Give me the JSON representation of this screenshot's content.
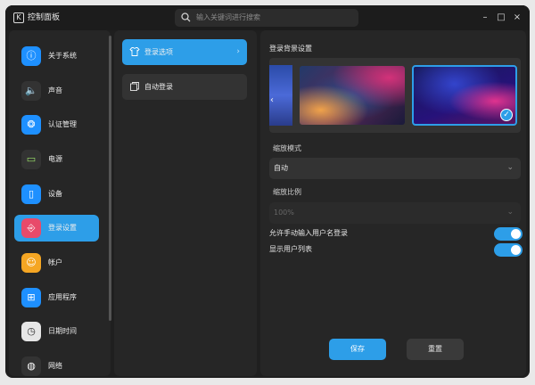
{
  "titlebar": {
    "app_title": "控制面板",
    "app_icon_glyph": "K",
    "search_placeholder": "输入关键词进行搜索",
    "minimize": "–",
    "maximize": "□",
    "close": "×"
  },
  "sidebar": {
    "items": [
      {
        "label": "关于系统",
        "icon": "info-icon",
        "glyph": "ⓘ",
        "color": "#1e90ff",
        "active": false
      },
      {
        "label": "声音",
        "icon": "speaker-icon",
        "glyph": "🔈",
        "color": "#333333",
        "active": false
      },
      {
        "label": "认证管理",
        "icon": "fingerprint-icon",
        "glyph": "❂",
        "color": "#1e90ff",
        "active": false
      },
      {
        "label": "电源",
        "icon": "battery-icon",
        "glyph": "▭",
        "color": "#333333",
        "active": false
      },
      {
        "label": "设备",
        "icon": "mouse-icon",
        "glyph": "▯",
        "color": "#1e90ff",
        "active": false
      },
      {
        "label": "登录设置",
        "icon": "login-icon",
        "glyph": "⎆",
        "color": "#e84a6a",
        "active": true
      },
      {
        "label": "帐户",
        "icon": "account-icon",
        "glyph": "☺",
        "color": "#f5a623",
        "active": false
      },
      {
        "label": "应用程序",
        "icon": "apps-icon",
        "glyph": "⊞",
        "color": "#1e90ff",
        "active": false
      },
      {
        "label": "日期时间",
        "icon": "clock-icon",
        "glyph": "◷",
        "color": "#e6e6e6",
        "active": false
      },
      {
        "label": "网络",
        "icon": "globe-icon",
        "glyph": "◍",
        "color": "#333333",
        "active": false
      }
    ]
  },
  "midpane": {
    "items": [
      {
        "label": "登录选项",
        "icon": "shirt-icon",
        "active": true
      },
      {
        "label": "自动登录",
        "icon": "copy-icon",
        "active": false
      }
    ],
    "chevron": "›"
  },
  "main": {
    "background_title": "登录背景设置",
    "scale_mode_label": "缩放模式",
    "scale_mode_value": "自动",
    "scale_ratio_label": "缩放比例",
    "scale_ratio_value": "100%",
    "manual_username_label": "允许手动输入用户名登录",
    "manual_username_enabled": true,
    "show_user_list_label": "显示用户列表",
    "show_user_list_enabled": true,
    "save_label": "保存",
    "reset_label": "重置",
    "wallpaper_prev": "‹",
    "check_glyph": "✓",
    "select_chevron": "⌄"
  },
  "colors": {
    "accent": "#2d9ee8",
    "window_bg": "#1f1f1f",
    "panel_bg": "#262626"
  }
}
